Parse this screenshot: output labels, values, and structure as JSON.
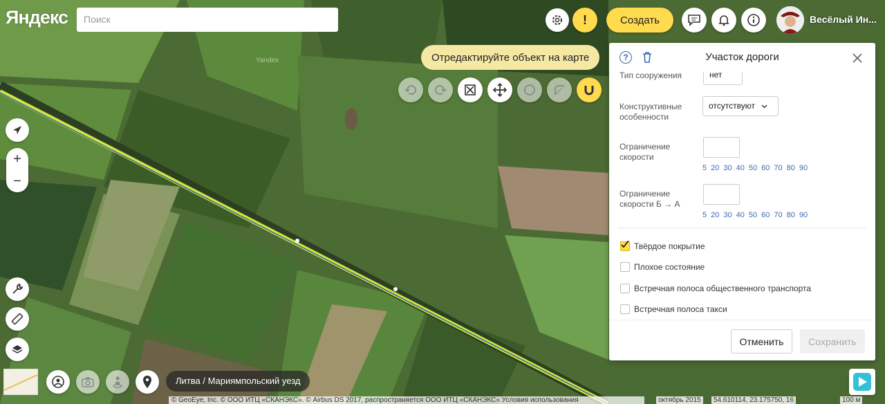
{
  "app": {
    "logo": "Яндекс"
  },
  "header": {
    "search_placeholder": "Поиск",
    "create_label": "Создать",
    "username": "Весёлый Ин..."
  },
  "map": {
    "hint": "Отредактируйте объект на карте",
    "watermark": "Yandex",
    "location": "Литва / Мариямпольский уезд",
    "copyright": "© GeoEye, Inc. © ООО ИТЦ «СКАНЭКС». © Airbus DS 2017, распространяется ООО ИТЦ «СКАНЭКС» Условия использования",
    "date": "октябрь 2015",
    "coords": "54.610114, 23.175750, 16",
    "scale": "100 м"
  },
  "panel": {
    "title": "Участок дороги",
    "structure_label": "Тип сооружения",
    "structure_value": "нет",
    "construction_label_1": "Конструктивные",
    "construction_label_2": "особенности",
    "construction_value": "отсутствуют",
    "speed_label_1": "Ограничение",
    "speed_label_2": "скорости",
    "speed_back_label_1": "Ограничение",
    "speed_back_label_2": "скорости Б → А",
    "speed_presets": [
      "5",
      "20",
      "30",
      "40",
      "50",
      "60",
      "70",
      "80",
      "90"
    ],
    "checkboxes": [
      {
        "label": "Твёрдое покрытие",
        "checked": true
      },
      {
        "label": "Плохое состояние",
        "checked": false
      },
      {
        "label": "Встречная полоса общественного транспорта",
        "checked": false
      },
      {
        "label": "Встречная полоса такси",
        "checked": false
      }
    ],
    "cancel_label": "Отменить",
    "save_label": "Сохранить"
  },
  "colors": {
    "accent": "#ffdb4d",
    "road": "#d7f53b",
    "hint_bg": "#f5e8a3"
  }
}
